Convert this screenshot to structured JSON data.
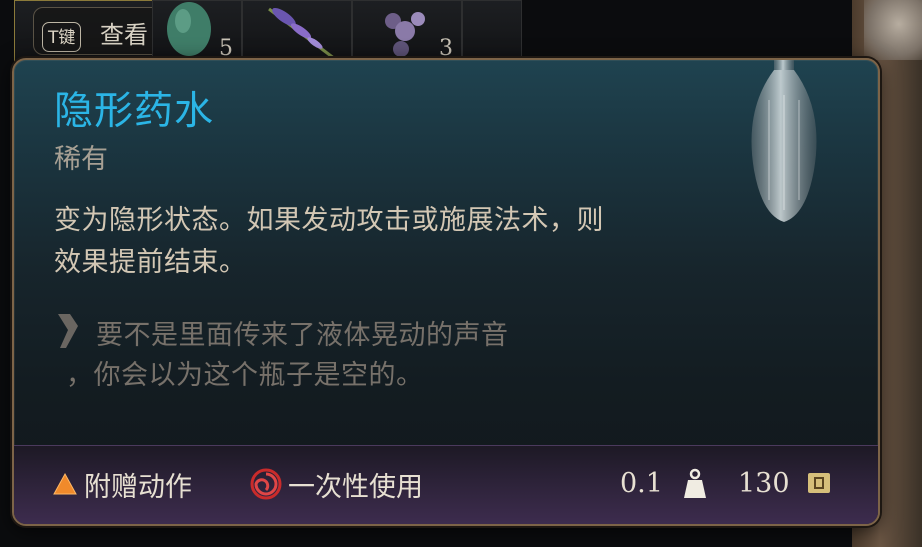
{
  "inventory": {
    "examine": {
      "key": "T键",
      "label": "查看"
    },
    "slots": [
      {
        "name": "green-potion-slot",
        "count": "5"
      },
      {
        "name": "lavender-herb-slot",
        "count": ""
      },
      {
        "name": "crystal-slot",
        "count": "3"
      }
    ]
  },
  "tooltip": {
    "item_name": "隐形药水",
    "rarity": "稀有",
    "description": "变为隐形状态。如果发动攻击或施展法术，则效果提前结束。",
    "flavor_line1": "要不是里面传来了液体晃动的声音",
    "flavor_line2": "，你会以为这个瓶子是空的。",
    "bottom": {
      "action_type": "附赠动作",
      "usage": "一次性使用",
      "weight": "0.1",
      "price": "130"
    },
    "colors": {
      "name": "#2bb5e6",
      "border": "#7d6448",
      "bonus_action": "#f08a2b",
      "single_use": "#c92b2b",
      "gold": "#d6bf7a"
    },
    "icons": {
      "action": "orange-triangle-icon",
      "usage": "red-spiral-icon",
      "weight": "weight-icon",
      "price": "gold-coin-icon",
      "flavor": "quote-mark-icon"
    }
  }
}
